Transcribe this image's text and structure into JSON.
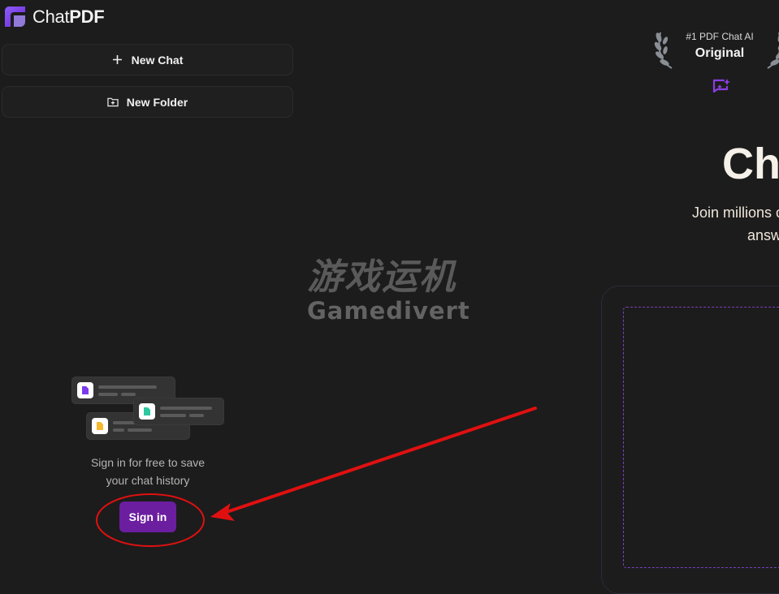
{
  "app": {
    "name_part1": "Chat",
    "name_part2": "PDF",
    "brand_color": "#7c3aed"
  },
  "sidebar": {
    "new_chat": {
      "label": "New Chat",
      "icon": "plus-icon"
    },
    "new_folder": {
      "label": "New Folder",
      "icon": "folder-plus-icon"
    },
    "signin_message_line1": "Sign in for free to save",
    "signin_message_line2": "your chat history",
    "signin_button": "Sign in",
    "signin_button_color": "#6b1ea0"
  },
  "watermark": {
    "cn": "游戏运机",
    "en": "Gamedivert"
  },
  "main": {
    "badge_top": "#1 PDF Chat AI",
    "badge_main": "Original",
    "hero_title": "Ch",
    "hero_sub1": "Join millions o",
    "hero_sub2": "answ"
  },
  "annotation": {
    "color": "#e01010",
    "shapes": [
      "ellipse",
      "arrow"
    ]
  }
}
